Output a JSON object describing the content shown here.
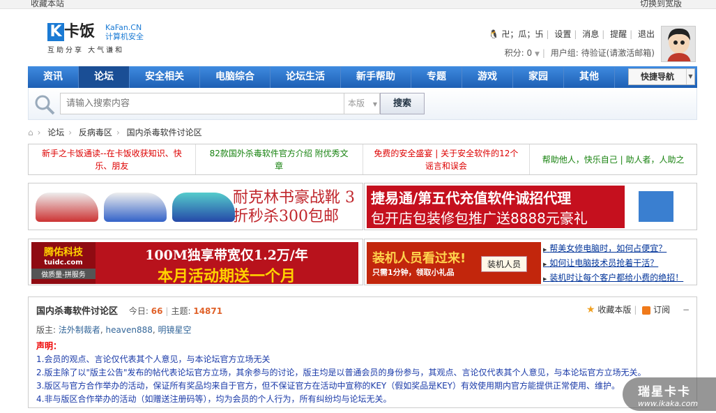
{
  "topbar": {
    "left": "收藏本站",
    "right": "切换到宽版"
  },
  "logo": {
    "mark": "K",
    "name": "卡饭",
    "en": "KaFan.CN",
    "tag": "计算机安全",
    "slogan": "互助分享  大气谦和"
  },
  "user": {
    "name": "卍；瓜；卐",
    "links": [
      "设置",
      "消息",
      "提醒",
      "退出"
    ],
    "points": "积分: 0",
    "group": "用户组: 待验证(请激活邮箱)"
  },
  "nav": {
    "items": [
      "资讯",
      "论坛",
      "安全相关",
      "电脑综合",
      "论坛生活",
      "新手帮助",
      "专题",
      "游戏",
      "家园",
      "其他"
    ],
    "active": 1,
    "quick": "快捷导航"
  },
  "search": {
    "placeholder": "请输入搜索内容",
    "scope": "本版",
    "button": "搜索"
  },
  "breadcrumb": [
    "论坛",
    "反病毒区",
    "国内杀毒软件讨论区"
  ],
  "notices": [
    {
      "text": "新手之卡饭通读--在卡饭收获知识、快乐、朋友",
      "color": "red"
    },
    {
      "text": "82款国外杀毒软件官方介绍 附优秀文章",
      "color": "green"
    },
    {
      "text": "免费的安全盛宴 | 关于安全软件的12个谣言和误会",
      "color": "red"
    },
    {
      "text": "帮助他人，快乐自己 | 助人者，人助之",
      "color": "green"
    }
  ],
  "ads": {
    "shoes": "耐克林书豪战靴 3折秒杀300包邮",
    "jyt1": "捷易通/第五代充值软件诚招代理",
    "jyt2": "包开店包装修包推广送8888元豪礼",
    "tengyou_brand": "腾佑科技",
    "tengyou_url": "tuidc.com",
    "tengyou_sub": "做质量-拼服务",
    "tengyou1": "100M独享带宽仅1.2万/年",
    "tengyou2": "本月活动期送一个月",
    "zj_title": "装机人员看过来!",
    "zj_sub": "只需1分钟，领取小礼品",
    "zj_btn": "装机人员",
    "links": [
      "帮美女修电脑时，如何占便宜？",
      "如何让电脑技术员抢着干活？",
      "装机时让每个客户都给小费的绝招！"
    ]
  },
  "forum": {
    "title": "国内杀毒软件讨论区",
    "today_label": "今日:",
    "today": "66",
    "topics_label": "主题:",
    "topics": "14871",
    "fav": "收藏本版",
    "sub": "订阅",
    "mods_label": "版主:",
    "mods": [
      "法外制裁者",
      "heaven888",
      "明镜星空"
    ],
    "decl_title": "声明：",
    "decl": [
      "1.会员的观点、言论仅代表其个人意见，与本论坛官方立场无关",
      "2.版主除了以\"版主公告\"发布的帖代表论坛官方立场，其余参与的讨论，版主均是以普通会员的身份参与，其观点、言论仅代表其个人意见，与本论坛官方立场无关。",
      "3.版区与官方合作举办的活动，保证所有奖品均来自于官方，但不保证官方在活动中宣称的KEY（假如奖品是KEY）有效使用期内官方能提供正常使用、维护。",
      "4.非与版区合作举办的活动（如赠送注册码等），均为会员的个人行为，所有纠纷均与论坛无关。"
    ]
  },
  "watermark": {
    "name": "瑞星卡卡",
    "url": "www.ikaka.com"
  },
  "colors": {
    "nav": "#2a6fc6",
    "accent": "#e0622a",
    "link": "#1a3aa8"
  }
}
